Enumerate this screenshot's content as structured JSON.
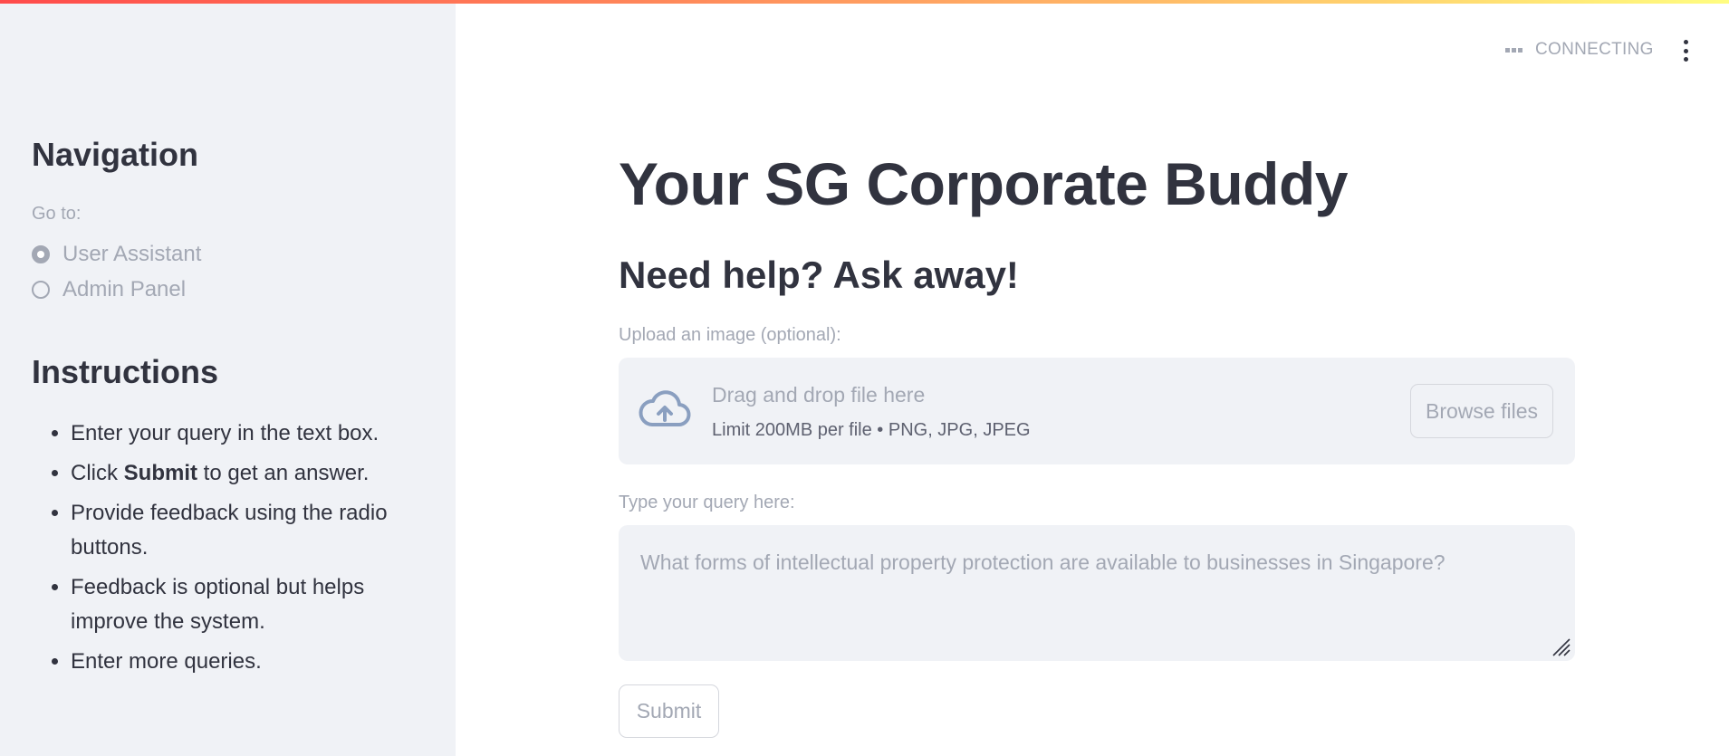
{
  "header": {
    "status_text": "CONNECTING",
    "status_icon": "connecting-dots-icon",
    "menu_icon": "kebab-menu-icon"
  },
  "sidebar": {
    "nav_title": "Navigation",
    "nav_label": "Go to:",
    "nav_options": [
      {
        "label": "User Assistant",
        "selected": true
      },
      {
        "label": "Admin Panel",
        "selected": false
      }
    ],
    "instructions_title": "Instructions",
    "instructions": [
      {
        "text": "Enter your query in the text box."
      },
      {
        "pre": "Click ",
        "bold": "Submit",
        "post": " to get an answer."
      },
      {
        "text": "Provide feedback using the radio buttons."
      },
      {
        "text": "Feedback is optional but helps improve the system."
      },
      {
        "text": "Enter more queries."
      }
    ]
  },
  "main": {
    "title": "Your SG Corporate Buddy",
    "subtitle": "Need help? Ask away!",
    "upload": {
      "label": "Upload an image (optional):",
      "drag_text": "Drag and drop file here",
      "limit_text": "Limit 200MB per file • PNG, JPG, JPEG",
      "browse_label": "Browse files",
      "icon": "cloud-upload-icon"
    },
    "query": {
      "label": "Type your query here:",
      "placeholder": "What forms of intellectual property protection are available to businesses in Singapore?",
      "value": ""
    },
    "submit_label": "Submit"
  },
  "colors": {
    "accent_gradient_start": "#ff4b4b",
    "accent_gradient_end": "#fffd80",
    "sidebar_bg": "#f0f2f6",
    "text_primary": "#31333f",
    "text_muted": "#a3a8b4",
    "icon_color": "#8a9fc0"
  }
}
